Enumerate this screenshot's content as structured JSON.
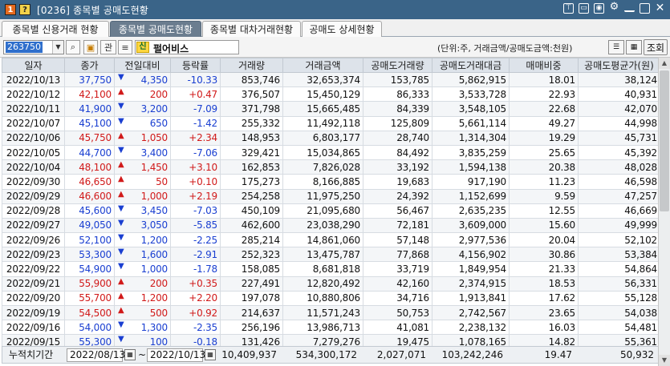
{
  "titlebar": {
    "badge1": "1",
    "badge2": "?",
    "title": "[0236] 종목별 공매도현황",
    "icons": [
      "pin-icon",
      "window-icon",
      "camera-icon",
      "gear-icon",
      "minimize-icon",
      "maximize-icon",
      "close-icon"
    ]
  },
  "tabs": [
    {
      "label": "종목별 신용거래 현황",
      "active": false
    },
    {
      "label": "종목별 공매도현황",
      "active": true
    },
    {
      "label": "종목별 대차거래현황",
      "active": false
    },
    {
      "label": "공매도 상세현황",
      "active": false
    }
  ],
  "toolbar": {
    "code": "263750",
    "btn_search": "🔍",
    "btn_gwan": "관",
    "sin_badge": "신",
    "stock_name": "펄어비스",
    "unit_text": "(단위:주, 거래금액/공매도금액:천원)",
    "query_label": "조회"
  },
  "table": {
    "headers": [
      "일자",
      "종가",
      "전일대비",
      "등락률",
      "거래량",
      "거래금액",
      "공매도거래량",
      "공매도거래대금",
      "매매비중",
      "공매도평균가(원)"
    ],
    "rows": [
      {
        "date": "2022/10/13",
        "close": "37,750",
        "dir": "down",
        "change": "4,350",
        "rate": "-10.33",
        "volume": "853,746",
        "amount": "32,653,374",
        "short_vol": "153,785",
        "short_amt": "5,862,915",
        "ratio": "18.01",
        "avg": "38,124"
      },
      {
        "date": "2022/10/12",
        "close": "42,100",
        "dir": "up",
        "change": "200",
        "rate": "+0.47",
        "volume": "376,507",
        "amount": "15,450,129",
        "short_vol": "86,333",
        "short_amt": "3,533,728",
        "ratio": "22.93",
        "avg": "40,931"
      },
      {
        "date": "2022/10/11",
        "close": "41,900",
        "dir": "down",
        "change": "3,200",
        "rate": "-7.09",
        "volume": "371,798",
        "amount": "15,665,485",
        "short_vol": "84,339",
        "short_amt": "3,548,105",
        "ratio": "22.68",
        "avg": "42,070"
      },
      {
        "date": "2022/10/07",
        "close": "45,100",
        "dir": "down",
        "change": "650",
        "rate": "-1.42",
        "volume": "255,332",
        "amount": "11,492,118",
        "short_vol": "125,809",
        "short_amt": "5,661,114",
        "ratio": "49.27",
        "avg": "44,998"
      },
      {
        "date": "2022/10/06",
        "close": "45,750",
        "dir": "up",
        "change": "1,050",
        "rate": "+2.34",
        "volume": "148,953",
        "amount": "6,803,177",
        "short_vol": "28,740",
        "short_amt": "1,314,304",
        "ratio": "19.29",
        "avg": "45,731"
      },
      {
        "date": "2022/10/05",
        "close": "44,700",
        "dir": "down",
        "change": "3,400",
        "rate": "-7.06",
        "volume": "329,421",
        "amount": "15,034,865",
        "short_vol": "84,492",
        "short_amt": "3,835,259",
        "ratio": "25.65",
        "avg": "45,392"
      },
      {
        "date": "2022/10/04",
        "close": "48,100",
        "dir": "up",
        "change": "1,450",
        "rate": "+3.10",
        "volume": "162,853",
        "amount": "7,826,028",
        "short_vol": "33,192",
        "short_amt": "1,594,138",
        "ratio": "20.38",
        "avg": "48,028"
      },
      {
        "date": "2022/09/30",
        "close": "46,650",
        "dir": "up",
        "change": "50",
        "rate": "+0.10",
        "volume": "175,273",
        "amount": "8,166,885",
        "short_vol": "19,683",
        "short_amt": "917,190",
        "ratio": "11.23",
        "avg": "46,598"
      },
      {
        "date": "2022/09/29",
        "close": "46,600",
        "dir": "up",
        "change": "1,000",
        "rate": "+2.19",
        "volume": "254,258",
        "amount": "11,975,250",
        "short_vol": "24,392",
        "short_amt": "1,152,699",
        "ratio": "9.59",
        "avg": "47,257"
      },
      {
        "date": "2022/09/28",
        "close": "45,600",
        "dir": "down",
        "change": "3,450",
        "rate": "-7.03",
        "volume": "450,109",
        "amount": "21,095,680",
        "short_vol": "56,467",
        "short_amt": "2,635,235",
        "ratio": "12.55",
        "avg": "46,669"
      },
      {
        "date": "2022/09/27",
        "close": "49,050",
        "dir": "down",
        "change": "3,050",
        "rate": "-5.85",
        "volume": "462,600",
        "amount": "23,038,290",
        "short_vol": "72,181",
        "short_amt": "3,609,000",
        "ratio": "15.60",
        "avg": "49,999"
      },
      {
        "date": "2022/09/26",
        "close": "52,100",
        "dir": "down",
        "change": "1,200",
        "rate": "-2.25",
        "volume": "285,214",
        "amount": "14,861,060",
        "short_vol": "57,148",
        "short_amt": "2,977,536",
        "ratio": "20.04",
        "avg": "52,102"
      },
      {
        "date": "2022/09/23",
        "close": "53,300",
        "dir": "down",
        "change": "1,600",
        "rate": "-2.91",
        "volume": "252,323",
        "amount": "13,475,787",
        "short_vol": "77,868",
        "short_amt": "4,156,902",
        "ratio": "30.86",
        "avg": "53,384"
      },
      {
        "date": "2022/09/22",
        "close": "54,900",
        "dir": "down",
        "change": "1,000",
        "rate": "-1.78",
        "volume": "158,085",
        "amount": "8,681,818",
        "short_vol": "33,719",
        "short_amt": "1,849,954",
        "ratio": "21.33",
        "avg": "54,864"
      },
      {
        "date": "2022/09/21",
        "close": "55,900",
        "dir": "up",
        "change": "200",
        "rate": "+0.35",
        "volume": "227,491",
        "amount": "12,820,492",
        "short_vol": "42,160",
        "short_amt": "2,374,915",
        "ratio": "18.53",
        "avg": "56,331"
      },
      {
        "date": "2022/09/20",
        "close": "55,700",
        "dir": "up",
        "change": "1,200",
        "rate": "+2.20",
        "volume": "197,078",
        "amount": "10,880,806",
        "short_vol": "34,716",
        "short_amt": "1,913,841",
        "ratio": "17.62",
        "avg": "55,128"
      },
      {
        "date": "2022/09/19",
        "close": "54,500",
        "dir": "up",
        "change": "500",
        "rate": "+0.92",
        "volume": "214,637",
        "amount": "11,571,243",
        "short_vol": "50,753",
        "short_amt": "2,742,567",
        "ratio": "23.65",
        "avg": "54,038"
      },
      {
        "date": "2022/09/16",
        "close": "54,000",
        "dir": "down",
        "change": "1,300",
        "rate": "-2.35",
        "volume": "256,196",
        "amount": "13,986,713",
        "short_vol": "41,081",
        "short_amt": "2,238,132",
        "ratio": "16.03",
        "avg": "54,481"
      },
      {
        "date": "2022/09/15",
        "close": "55,300",
        "dir": "down",
        "change": "100",
        "rate": "-0.18",
        "volume": "131,426",
        "amount": "7,279,276",
        "short_vol": "19,475",
        "short_amt": "1,078,165",
        "ratio": "14.82",
        "avg": "55,361"
      }
    ]
  },
  "footer": {
    "label": "누적치기간",
    "from": "2022/08/13",
    "tilde": "~",
    "to": "2022/10/13",
    "volume": "10,409,937",
    "amount": "534,300,172",
    "short_vol": "2,027,071",
    "short_amt": "103,242,246",
    "ratio": "19.47",
    "avg": "50,932"
  },
  "colors": {
    "up": "#d11a1a",
    "down": "#1a3fd1",
    "title_bar": "#3a6488",
    "active_tab": "#6b7d8f"
  }
}
